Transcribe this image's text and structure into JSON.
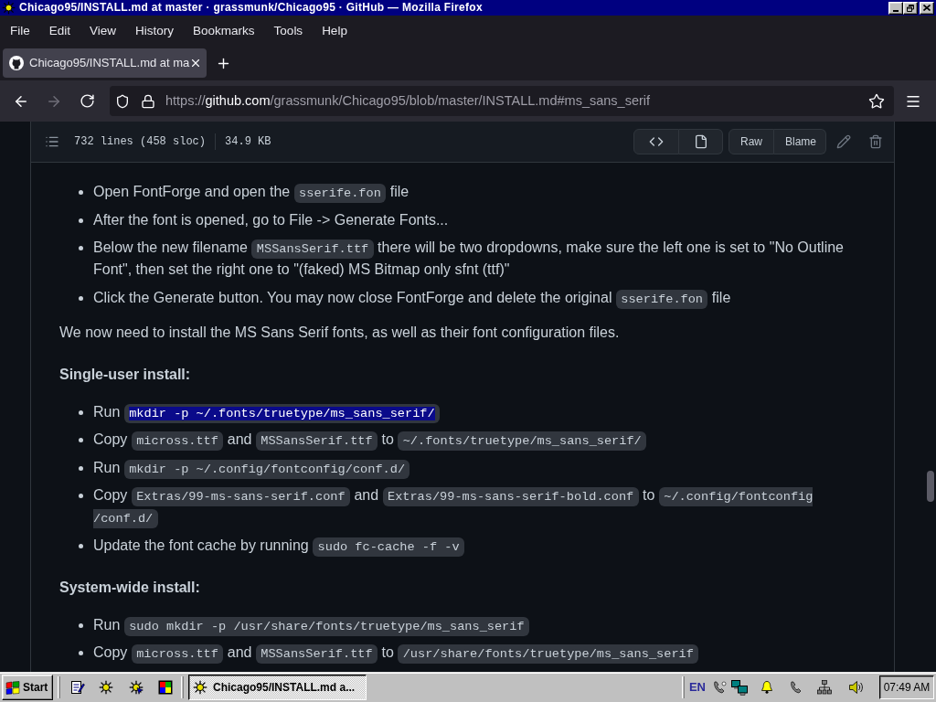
{
  "window": {
    "title": "Chicago95/INSTALL.md at master · grassmunk/Chicago95 · GitHub — Mozilla Firefox"
  },
  "menu_bar": [
    "File",
    "Edit",
    "View",
    "History",
    "Bookmarks",
    "Tools",
    "Help"
  ],
  "tabs": [
    {
      "title": "Chicago95/INSTALL.md at ma",
      "selected": true
    }
  ],
  "navigation": {
    "back": {
      "disabled": false
    },
    "forward": {
      "disabled": true
    }
  },
  "address_bar": {
    "scheme": "https://",
    "host": "github.com",
    "path": "/grassmunk/Chicago95/blob/master/INSTALL.md#ms_sans_serif"
  },
  "file_header": {
    "line_count": "732 lines (458 sloc)",
    "size": "34.9 KB",
    "actions": [
      "Raw",
      "Blame"
    ]
  },
  "article": {
    "blocks": [
      {
        "kind": "list",
        "items": [
          {
            "segments": [
              {
                "kind": "text",
                "text": "Open FontForge and open the "
              },
              {
                "kind": "code",
                "text": "sserife.fon",
                "highlighted": false
              },
              {
                "kind": "text",
                "text": " file"
              }
            ]
          },
          {
            "segments": [
              {
                "kind": "text",
                "text": "After the font is opened, go to File -> Generate Fonts..."
              }
            ]
          },
          {
            "segments": [
              {
                "kind": "text",
                "text": "Below the new filename "
              },
              {
                "kind": "code",
                "text": "MSSansSerif.ttf",
                "highlighted": false
              },
              {
                "kind": "text",
                "text": " there will be two dropdowns, make sure the left one is set to \"No Outline Font\", then set the right one to \"(faked) MS Bitmap only sfnt (ttf)\""
              }
            ]
          },
          {
            "segments": [
              {
                "kind": "text",
                "text": "Click the Generate button. You may now close FontForge and delete the original "
              },
              {
                "kind": "code",
                "text": "sserife.fon",
                "highlighted": false
              },
              {
                "kind": "text",
                "text": " file"
              }
            ]
          }
        ]
      },
      {
        "kind": "paragraph",
        "text": "We now need to install the MS Sans Serif fonts, as well as their font configuration files."
      },
      {
        "kind": "heading",
        "text": "Single-user install:"
      },
      {
        "kind": "list",
        "items": [
          {
            "segments": [
              {
                "kind": "text",
                "text": "Run "
              },
              {
                "kind": "code",
                "text": "mkdir -p ~/.fonts/truetype/ms_sans_serif/",
                "highlighted": true
              }
            ]
          },
          {
            "segments": [
              {
                "kind": "text",
                "text": "Copy "
              },
              {
                "kind": "code",
                "text": "micross.ttf",
                "highlighted": false
              },
              {
                "kind": "text",
                "text": " and "
              },
              {
                "kind": "code",
                "text": "MSSansSerif.ttf",
                "highlighted": false
              },
              {
                "kind": "text",
                "text": " to "
              },
              {
                "kind": "code",
                "text": "~/.fonts/truetype/ms_sans_serif/",
                "highlighted": false
              }
            ]
          },
          {
            "segments": [
              {
                "kind": "text",
                "text": "Run "
              },
              {
                "kind": "code",
                "text": "mkdir -p ~/.config/fontconfig/conf.d/",
                "highlighted": false
              }
            ]
          },
          {
            "segments": [
              {
                "kind": "text",
                "text": "Copy "
              },
              {
                "kind": "code",
                "text": "Extras/99-ms-sans-serif.conf",
                "highlighted": false
              },
              {
                "kind": "text",
                "text": " and "
              },
              {
                "kind": "code",
                "text": "Extras/99-ms-sans-serif-bold.conf",
                "highlighted": false
              },
              {
                "kind": "text",
                "text": " to "
              },
              {
                "kind": "code",
                "text": "~/.config/fontconfig/conf.d/",
                "highlighted": false
              }
            ]
          },
          {
            "segments": [
              {
                "kind": "text",
                "text": "Update the font cache by running "
              },
              {
                "kind": "code",
                "text": "sudo fc-cache -f -v",
                "highlighted": false
              }
            ]
          }
        ]
      },
      {
        "kind": "heading",
        "text": "System-wide install:"
      },
      {
        "kind": "list",
        "items": [
          {
            "segments": [
              {
                "kind": "text",
                "text": "Run "
              },
              {
                "kind": "code",
                "text": "sudo mkdir -p /usr/share/fonts/truetype/ms_sans_serif",
                "highlighted": false
              }
            ]
          },
          {
            "segments": [
              {
                "kind": "text",
                "text": "Copy "
              },
              {
                "kind": "code",
                "text": "micross.ttf",
                "highlighted": false
              },
              {
                "kind": "text",
                "text": " and "
              },
              {
                "kind": "code",
                "text": "MSSansSerif.ttf",
                "highlighted": false
              },
              {
                "kind": "text",
                "text": " to "
              },
              {
                "kind": "code",
                "text": "/usr/share/fonts/truetype/ms_sans_serif",
                "highlighted": false
              }
            ]
          }
        ]
      }
    ]
  },
  "taskbar": {
    "start": "Start",
    "tasks": [
      {
        "title": "Chicago95/INSTALL.md a...",
        "selected": true
      }
    ],
    "input_language": "EN",
    "clock": "07:49 AM"
  }
}
